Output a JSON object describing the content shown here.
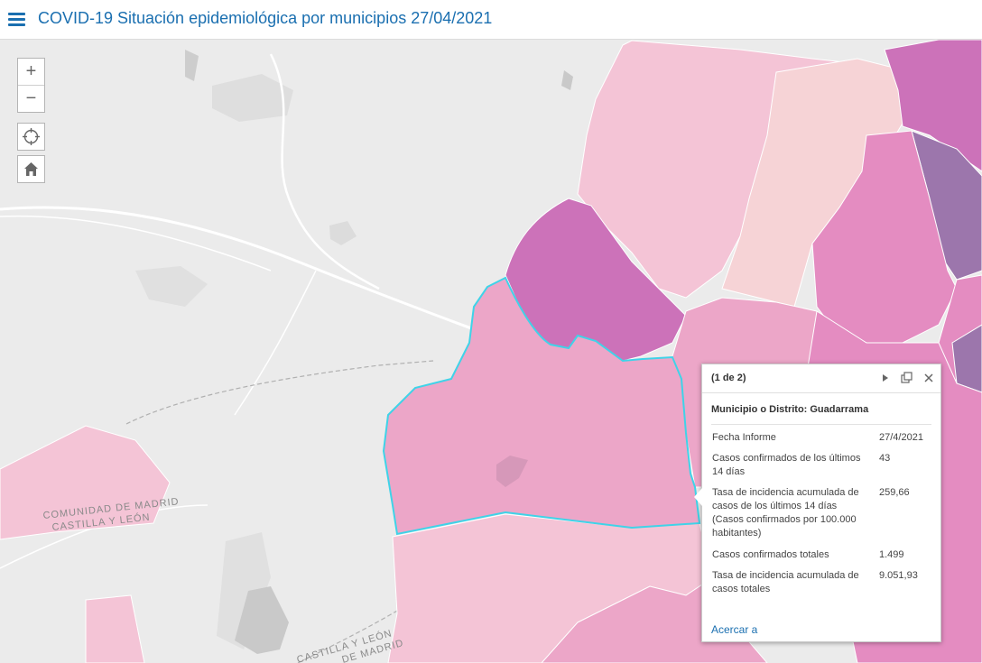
{
  "header": {
    "title": "COVID-19 Situación epidemiológica por municipios 27/04/2021"
  },
  "controls": {
    "zoom_in": "+",
    "zoom_out": "−",
    "locate_icon": "locate-icon",
    "home_icon": "home-icon"
  },
  "map": {
    "labels": {
      "region_upper_left": "COMUNIDAD DE MADRID",
      "region_lower_left": "CASTILLA Y LEÓN",
      "region_lower_bottom": "CASTILLA Y LEÓN",
      "region_upper_bottom": "DE MADRID"
    },
    "colors": {
      "base": "#ebebeb",
      "selected_outline": "#3fd3e8",
      "light": "#f4c4d6",
      "lighter": "#f6d3d6",
      "medium": "#eca6c8",
      "strong": "#e48cc1",
      "dark": "#cc72b9",
      "darkest": "#9c76ac"
    }
  },
  "popup": {
    "pager": "(1 de 2)",
    "title": "Municipio o Distrito: Guadarrama",
    "rows": [
      {
        "label": "Fecha Informe",
        "value": "27/4/2021"
      },
      {
        "label": "Casos confirmados de los últimos 14 días",
        "value": "43"
      },
      {
        "label": "Tasa de incidencia acumulada de casos de los últimos 14 días (Casos confirmados por 100.000 habitantes)",
        "value": "259,66"
      },
      {
        "label": "Casos confirmados totales",
        "value": "1.499"
      },
      {
        "label": "Tasa de incidencia acumulada de casos totales",
        "value": "9.051,93"
      }
    ],
    "zoom_link": "Acercar a",
    "next_icon": "next-icon",
    "dock_icon": "dock-icon",
    "close_icon": "close-icon"
  }
}
